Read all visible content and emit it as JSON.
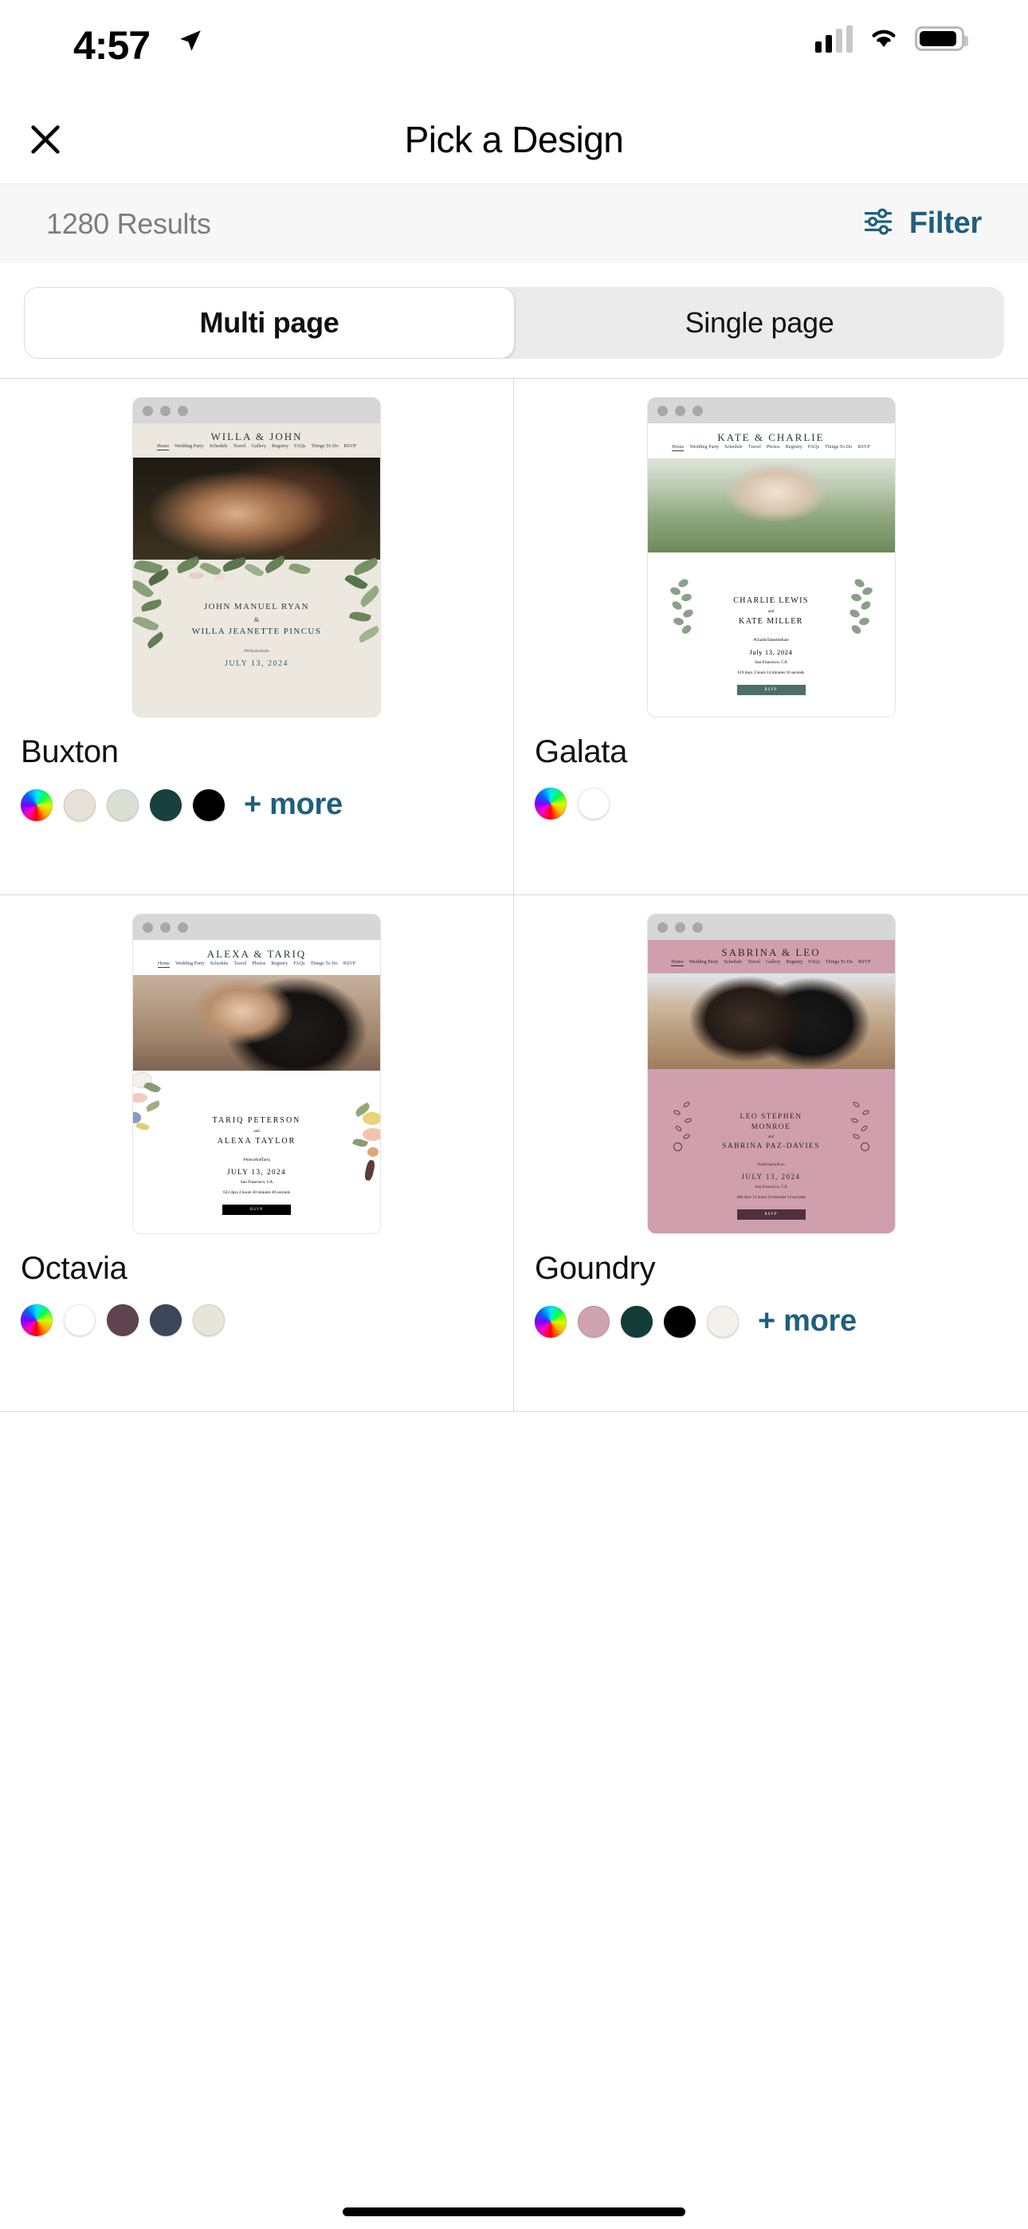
{
  "status_bar": {
    "time": "4:57",
    "location_icon": "location-arrow-icon",
    "signal_icon": "cellular-signal-icon",
    "wifi_icon": "wifi-icon",
    "battery_icon": "battery-icon"
  },
  "header": {
    "close_icon": "close-icon",
    "title": "Pick a Design"
  },
  "results_bar": {
    "count_label": "1280 Results",
    "filter_label": "Filter",
    "filter_icon": "sliders-icon",
    "filter_color": "#1f5f7e"
  },
  "segmented_control": {
    "options": [
      {
        "label": "Multi page",
        "selected": true
      },
      {
        "label": "Single page",
        "selected": false
      }
    ]
  },
  "more_label": "+ more",
  "designs": [
    {
      "name": "Buxton",
      "site": {
        "names": "WILLA & JOHN",
        "nav": [
          "Home",
          "Wedding Party",
          "Schedule",
          "Travel",
          "Gallery",
          "Registry",
          "FAQs",
          "Things To Do",
          "RSVP"
        ],
        "partner_one": "JOHN MANUEL RYAN",
        "and": "&",
        "partner_two": "WILLA JEANETTE PINCUS",
        "hashtag": "#WillaAndJohn",
        "date": "JULY 13, 2024",
        "location": "",
        "countdown": "",
        "rsvp_label": ""
      },
      "swatches": [
        "rainbow",
        "#e6e0d8",
        "#d7e0d3",
        "#17413f",
        "#000000"
      ],
      "has_more": true
    },
    {
      "name": "Galata",
      "site": {
        "names": "KATE & CHARLIE",
        "nav": [
          "Home",
          "Wedding Party",
          "Schedule",
          "Travel",
          "Photos",
          "Registry",
          "FAQs",
          "Things To Do",
          "RSVP"
        ],
        "partner_one": "CHARLIE LEWIS",
        "and": "and",
        "partner_two": "KATE MILLER",
        "hashtag": "#CharlieTakestheKate",
        "date": "July 13, 2024",
        "location": "San Francisco, CA",
        "countdown": "619 days 3 hours 14 minutes 10 seconds",
        "rsvp_label": "RSVP"
      },
      "swatches": [
        "rainbow",
        "#ffffff"
      ],
      "has_more": false
    },
    {
      "name": "Octavia",
      "site": {
        "names": "ALEXA & TARIQ",
        "nav": [
          "Home",
          "Wedding Party",
          "Schedule",
          "Travel",
          "Photos",
          "Registry",
          "FAQs",
          "Things To Do",
          "RSVP"
        ],
        "partner_one": "TARIQ PETERSON",
        "and": "and",
        "partner_two": "ALEXA TAYLOR",
        "hashtag": "#AlexaAndTariq",
        "date": "JULY 13, 2024",
        "location": "San Francisco, CA",
        "countdown": "623 days 2 hours 30 minutes 49 seconds",
        "rsvp_label": "RSVP"
      },
      "swatches": [
        "rainbow",
        "#ffffff",
        "#5f4450",
        "#3c4859",
        "#e7e4d8"
      ],
      "has_more": false
    },
    {
      "name": "Goundry",
      "site": {
        "names": "SABRINA & LEO",
        "nav": [
          "Home",
          "Wedding Party",
          "Schedule",
          "Travel",
          "Gallery",
          "Registry",
          "FAQs",
          "Things To Do",
          "RSVP"
        ],
        "partner_one": "LEO STEPHEN MONROE",
        "and": "and",
        "partner_two": "SABRINA PAZ-DAVIES",
        "hashtag": "#SabrinaAndLeo",
        "date": "JULY 13, 2024",
        "location": "San Francisco, CA",
        "countdown": "406 days  12 hours  26 minutes  54 seconds",
        "rsvp_label": "RSVP"
      },
      "swatches": [
        "rainbow",
        "#cfa3ad",
        "#143c38",
        "#000000",
        "#f4f0ec"
      ],
      "has_more": true
    }
  ]
}
